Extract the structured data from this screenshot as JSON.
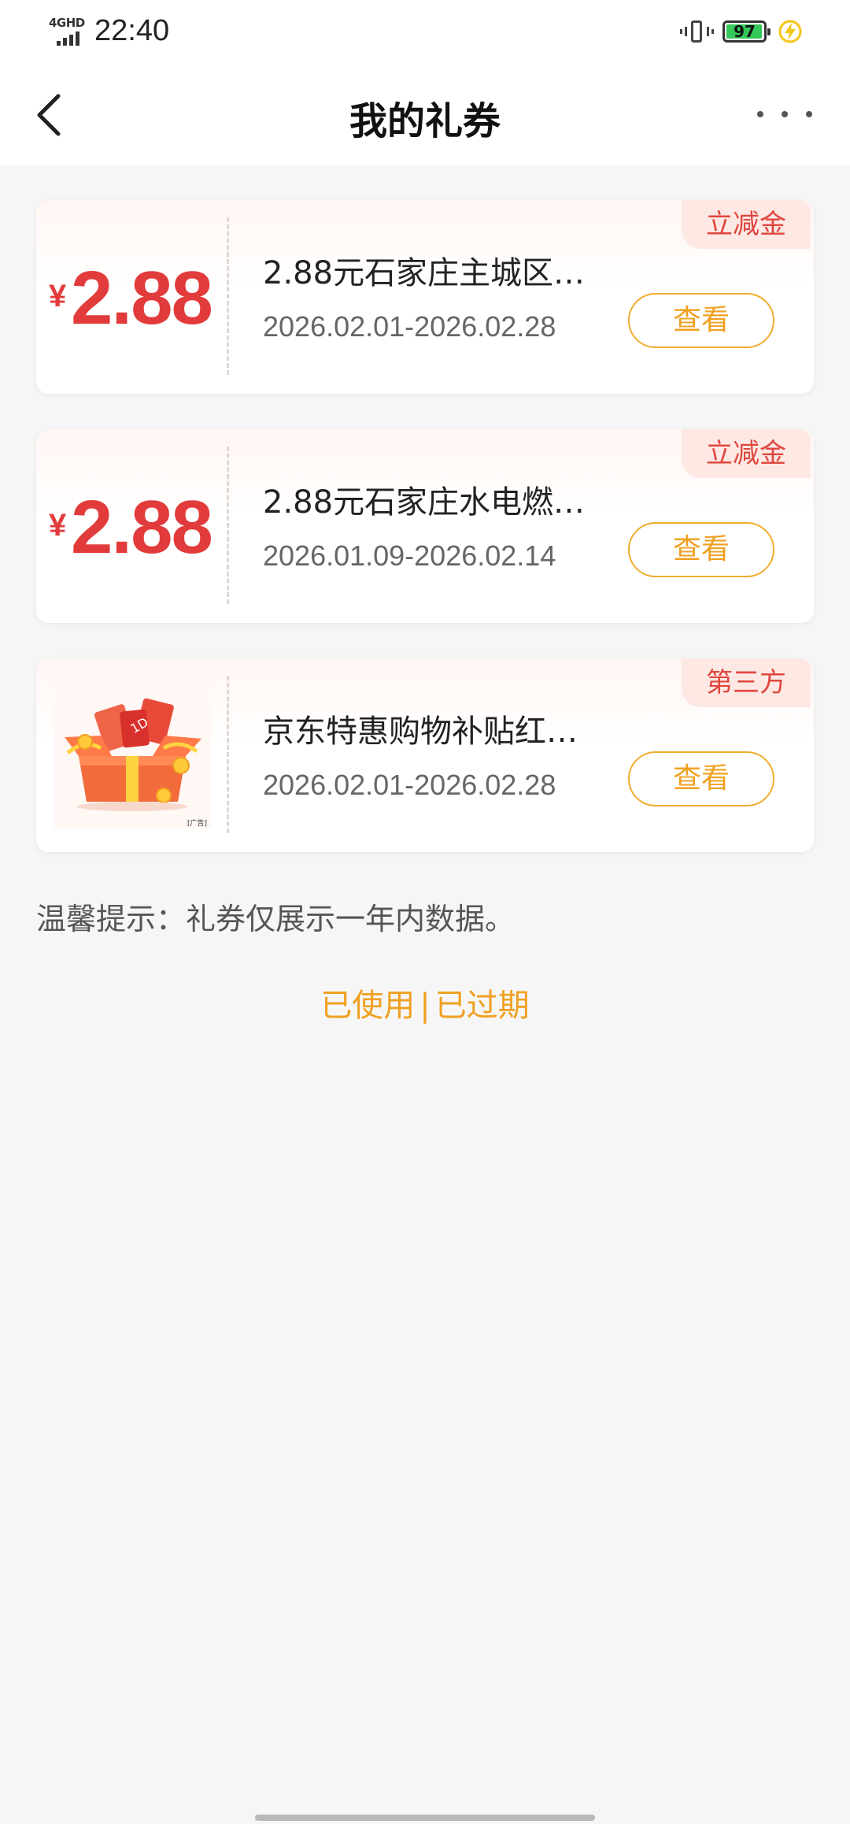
{
  "status_bar": {
    "network": "4GHD",
    "time": "22:40",
    "battery_level": "97",
    "icons": [
      "signal-icon",
      "vibrate-icon",
      "battery-icon",
      "charging-icon"
    ]
  },
  "header": {
    "title": "我的礼券",
    "back_icon": "chevron-left-icon",
    "more_icon": "more-horizontal-icon"
  },
  "coupons": [
    {
      "tag": "立减金",
      "currency": "¥",
      "amount": "2.88",
      "title": "2.88元石家庄主城区…",
      "date_range": "2026.02.01-2026.02.28",
      "button": "查看"
    },
    {
      "tag": "立减金",
      "currency": "¥",
      "amount": "2.88",
      "title": "2.88元石家庄水电燃…",
      "date_range": "2026.01.09-2026.02.14",
      "button": "查看"
    },
    {
      "tag": "第三方",
      "thumbnail": "gift-box-image",
      "thumbnail_badge": "[广告]",
      "title": "京东特惠购物补贴红…",
      "date_range": "2026.02.01-2026.02.28",
      "button": "查看"
    }
  ],
  "tip": "温馨提示：礼券仅展示一年内数据。",
  "links": {
    "used": "已使用",
    "separator": "|",
    "expired": "已过期"
  },
  "colors": {
    "accent_red": "#e23b3b",
    "accent_orange": "#f0a020",
    "tag_bg": "#fde8e4",
    "page_bg": "#f6f6f6"
  }
}
